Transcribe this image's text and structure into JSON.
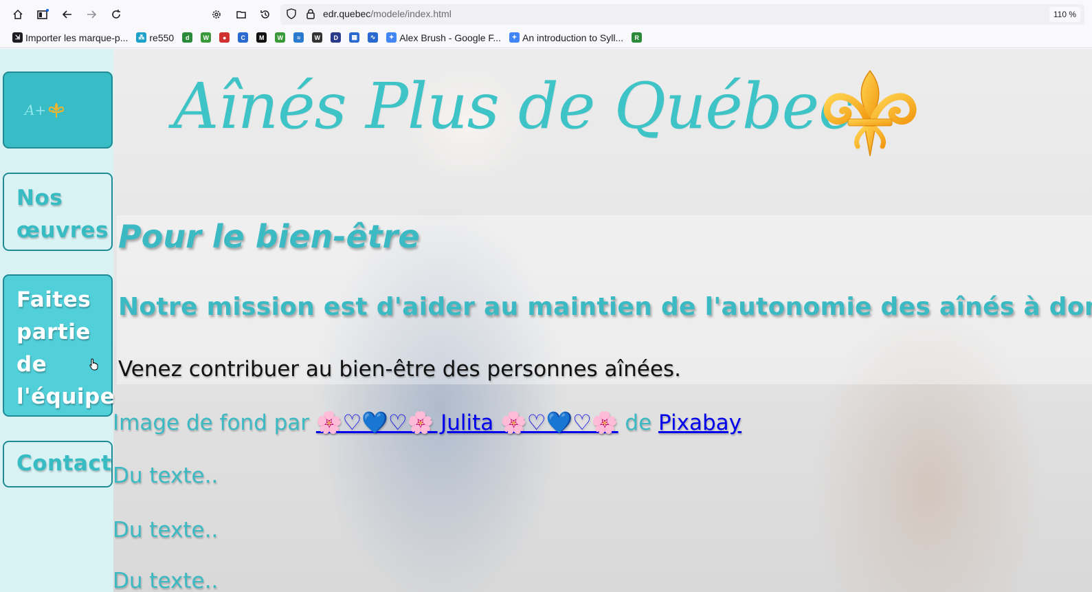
{
  "browser": {
    "url_host": "edr.quebec",
    "url_path": "/modele/index.html",
    "zoom": "110 %",
    "bookmarks": [
      {
        "label": "Importer les marque-p...",
        "icon": "import-icon",
        "color": "#1c1b22"
      },
      {
        "label": "re550",
        "icon": "re550-icon",
        "color": "#1ea1c8"
      },
      {
        "label": "",
        "icon": "green-circle-icon",
        "color": "#2a8a3a"
      },
      {
        "label": "",
        "icon": "w-green-icon",
        "color": "#3a9a3a"
      },
      {
        "label": "",
        "icon": "red-circle-icon",
        "color": "#d03030"
      },
      {
        "label": "",
        "icon": "c-blue-icon",
        "color": "#2a6ad0"
      },
      {
        "label": "",
        "icon": "m-black-icon",
        "color": "#111111"
      },
      {
        "label": "",
        "icon": "w-green2-icon",
        "color": "#3a9a3a"
      },
      {
        "label": "",
        "icon": "feather-icon",
        "color": "#2a7ad0"
      },
      {
        "label": "",
        "icon": "wikipedia-icon",
        "color": "#333333"
      },
      {
        "label": "",
        "icon": "dons-icon",
        "color": "#2a3a8a"
      },
      {
        "label": "",
        "icon": "museum-icon",
        "color": "#2a6ad0"
      },
      {
        "label": "",
        "icon": "wave-icon",
        "color": "#2a6ad0"
      },
      {
        "label": "Alex Brush - Google F...",
        "icon": "google-fonts-icon",
        "color": "#4285f4"
      },
      {
        "label": "An introduction to Syll...",
        "icon": "google-fonts-icon",
        "color": "#4285f4"
      },
      {
        "label": "",
        "icon": "ir-green-icon",
        "color": "#2a8a3a"
      }
    ]
  },
  "colors": {
    "accent": "#3bbac4",
    "nav_active": "#52d0da",
    "nav_bg": "#d9f3f5",
    "link": "#0000ee"
  },
  "site": {
    "title": "Aînés Plus de Québec",
    "logo_text": "A+",
    "nav": {
      "oeuvres": "Nos œuvres",
      "equipe": "Faites partie de l'équipe",
      "contact": "Contact"
    },
    "heading": "Pour le bien-être",
    "mission": "Notre mission est d'aider au maintien de l'autonomie des aînés à domicile.",
    "lead": "Venez contribuer au bien-être des personnes aînées.",
    "credit": {
      "prefix": "Image de fond par ",
      "author": "🌸♡💙♡🌸 Julita 🌸♡💙♡🌸",
      "middle": " de ",
      "source": "Pixabay"
    },
    "paragraphs": [
      "Du texte..",
      "Du texte..",
      "Du texte.."
    ]
  }
}
